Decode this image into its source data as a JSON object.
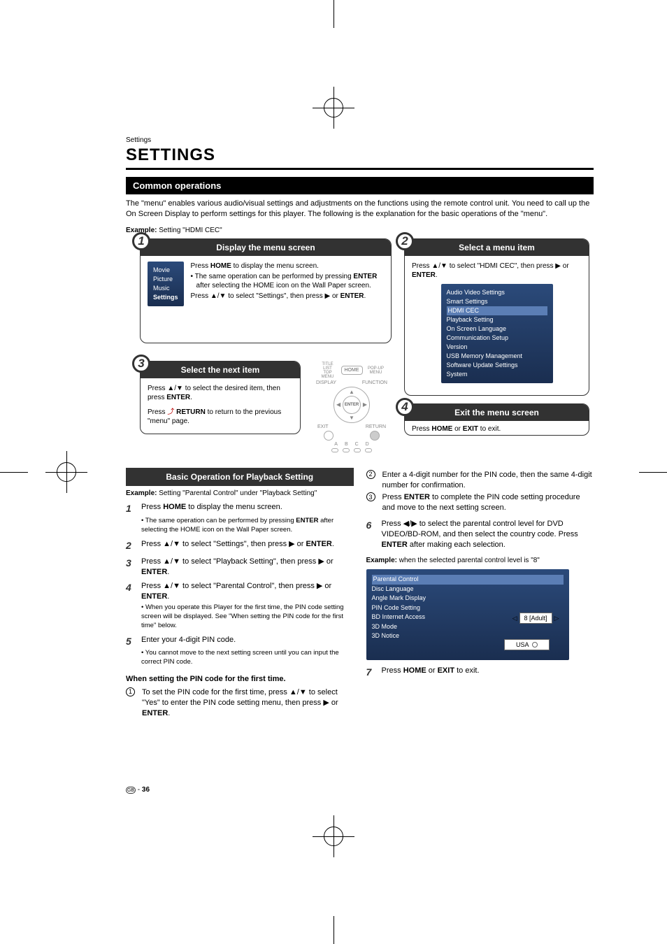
{
  "preTitle": "Settings",
  "title": "SETTINGS",
  "section1": "Common operations",
  "intro": "The \"menu\" enables various audio/visual settings and adjustments on the functions using the remote control unit. You need to call up the On Screen Display to perform settings for this player. The following is the explanation for the basic operations of the \"menu\".",
  "exampleLabel": "Example:",
  "exampleText": " Setting \"HDMI CEC\"",
  "box1": {
    "num": "1",
    "title": "Display the menu screen",
    "menu": {
      "items": [
        "Movie",
        "Picture",
        "Music",
        "Settings"
      ],
      "selected": 3
    },
    "line1a": "Press ",
    "line1b": "HOME",
    "line1c": " to display the menu screen.",
    "bullet1a": "The same operation can be performed by pressing ",
    "bullet1b": "ENTER",
    "bullet1c": " after selecting the HOME icon on the Wall Paper screen.",
    "line2a": "Press ▲/▼ to select \"Settings\", then press ▶ or ",
    "line2b": "ENTER",
    "line2c": "."
  },
  "box2": {
    "num": "2",
    "title": "Select a menu item",
    "line1a": "Press ▲/▼ to select \"HDMI CEC\", then press ▶ or ",
    "line1b": "ENTER",
    "line1c": ".",
    "menu": {
      "items": [
        "Audio Video Settings",
        "Smart Settings",
        "HDMI CEC",
        "Playback Setting",
        "On Screen Language",
        "Communication Setup",
        "Version",
        "USB Memory Management",
        "Software Update Settings",
        "System"
      ],
      "selected": 2
    }
  },
  "box3": {
    "num": "3",
    "title": "Select the next item",
    "line1a": "Press ▲/▼ to select the desired item, then press ",
    "line1b": "ENTER",
    "line1c": ".",
    "line2a": "Press ",
    "line2b": " RETURN",
    "line2c": " to return to the previous \"menu\" page."
  },
  "box4": {
    "num": "4",
    "title": "Exit the menu screen",
    "line1a": "Press ",
    "line1b": "HOME",
    "line1c": " or ",
    "line1d": "EXIT",
    "line1e": " to exit."
  },
  "remote": {
    "top": [
      "TITLE LIST TOP MENU",
      "HOME",
      "POP-UP MENU"
    ],
    "labels": {
      "display": "DISPLAY",
      "function": "FUNCTION",
      "enter": "ENTER",
      "exit": "EXIT",
      "return": "RETURN"
    },
    "letters": [
      "A",
      "B",
      "C",
      "D"
    ]
  },
  "basic": {
    "title": "Basic Operation for Playback Setting",
    "exampleLabel": "Example:",
    "exampleText": " Setting \"Parental Control\" under \"Playback Setting\"",
    "steps": {
      "s1": {
        "n": "1",
        "a": "Press ",
        "b": "HOME",
        "c": " to display the menu screen.",
        "sub_a": "The same operation can be performed by pressing ",
        "sub_b": "ENTER",
        "sub_c": " after selecting the HOME icon on the Wall Paper screen."
      },
      "s2": {
        "n": "2",
        "a": "Press ▲/▼ to select \"Settings\", then press ▶ or ",
        "b": "ENTER",
        "c": "."
      },
      "s3": {
        "n": "3",
        "a": "Press ▲/▼ to select \"Playback Setting\", then press ▶ or ",
        "b": "ENTER",
        "c": "."
      },
      "s4": {
        "n": "4",
        "a": "Press ▲/▼ to select \"Parental Control\", then press ▶ or ",
        "b": "ENTER",
        "c": ".",
        "sub": "When you operate this Player for the first time, the PIN code setting screen will be displayed. See \"When setting the PIN code for the first time\" below."
      },
      "s5": {
        "n": "5",
        "a": "Enter your 4-digit PIN code.",
        "sub": "You cannot move to the next setting screen until you can input the correct PIN code."
      }
    },
    "pinHeading": "When setting the PIN code for the first time.",
    "p1": {
      "n": "1",
      "a": "To set the PIN code for the first time, press ▲/▼ to select \"Yes\" to enter the PIN code setting menu, then press ▶ or ",
      "b": "ENTER",
      "c": "."
    },
    "p2": {
      "n": "2",
      "a": "Enter a 4-digit number for the PIN code, then the same 4-digit number for confirmation."
    },
    "p3": {
      "n": "3",
      "a": "Press ",
      "b": "ENTER",
      "c": " to complete the PIN code setting procedure and move to the next setting screen."
    },
    "s6": {
      "n": "6",
      "a": "Press ◀/▶ to select the parental control level for DVD VIDEO/BD-ROM, and then select the country code. Press ",
      "b": "ENTER",
      "c": " after making each selection."
    },
    "example2Label": "Example:",
    "example2Text": " when the selected parental control level is \"8\"",
    "parentalMenu": {
      "items": [
        "Parental Control",
        "Disc Language",
        "Angle Mark Display",
        "PIN Code Setting",
        "BD Internet Access",
        "3D Mode",
        "3D Notice"
      ],
      "selected": 0,
      "spinnerValue": "8 [Adult]",
      "country": "USA"
    },
    "s7": {
      "n": "7",
      "a": "Press ",
      "b": "HOME",
      "c": " or ",
      "d": "EXIT",
      "e": " to exit."
    }
  },
  "pageNum": "36",
  "gb": "GB"
}
